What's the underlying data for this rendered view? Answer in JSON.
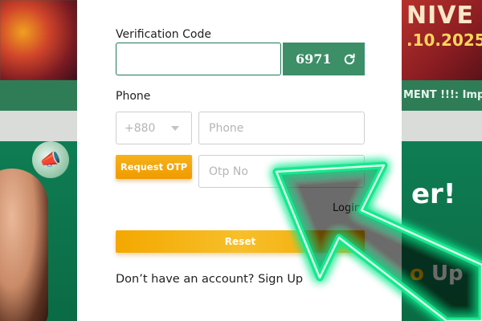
{
  "background": {
    "banner_title": "NIVE",
    "banner_date": ".10.2025",
    "marquee_text": "MENT !!!: Imp",
    "promo_word": "er!",
    "promo_up_prefix": "o",
    "promo_up_word": "Up"
  },
  "form": {
    "verification_label": "Verification Code",
    "verification_value": "",
    "captcha_code": "6971",
    "phone_label": "Phone",
    "country_code": "+880",
    "phone_placeholder": "Phone",
    "otp_button": "Request OTP",
    "otp_placeholder": "Otp No",
    "login_link": "Login",
    "reset_button": "Reset",
    "signup_text": "Don’t have an account?",
    "signup_link": "Sign Up"
  },
  "colors": {
    "brand_green": "#3d8f67",
    "accent_orange": "#f4a800",
    "arrow_glow": "#1dff9a"
  }
}
